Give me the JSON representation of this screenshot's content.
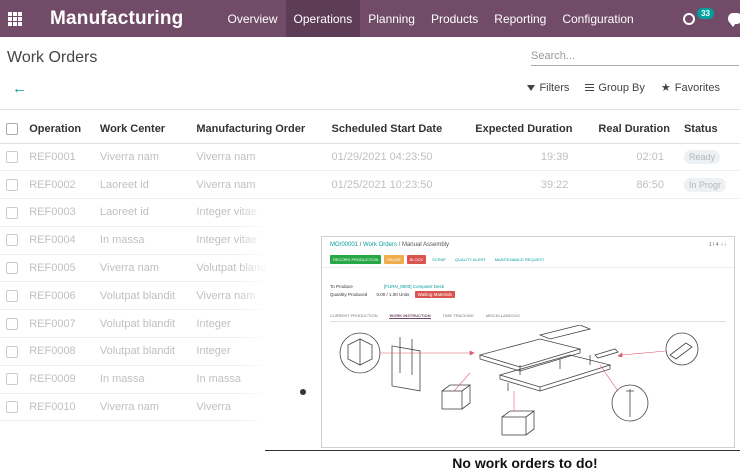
{
  "navbar": {
    "app_title": "Manufacturing",
    "menu": [
      "Overview",
      "Operations",
      "Planning",
      "Products",
      "Reporting",
      "Configuration"
    ],
    "active_menu": "Operations",
    "activity_count": "33",
    "color": "#714B67"
  },
  "control_panel": {
    "breadcrumb": "Work Orders",
    "search_placeholder": "Search...",
    "filters_label": "Filters",
    "group_by_label": "Group By",
    "favorites_label": "Favorites"
  },
  "table": {
    "columns": [
      "Operation",
      "Work Center",
      "Manufacturing Order",
      "Scheduled Start Date",
      "Expected Duration",
      "Real Duration",
      "Status"
    ],
    "rows": [
      {
        "operation": "REF0001",
        "work_center": "Viverra nam",
        "mo": "Viverra nam",
        "start": "01/29/2021 04:23:50",
        "expected": "19:39",
        "real": "02:01",
        "status": "Ready"
      },
      {
        "operation": "REF0002",
        "work_center": "Laoreet id",
        "mo": "Viverra nam",
        "start": "01/25/2021 10:23:50",
        "expected": "39:22",
        "real": "86:50",
        "status": "In Progr"
      },
      {
        "operation": "REF0003",
        "work_center": "Laoreet id",
        "mo": "Integer vitae",
        "start": "",
        "expected": "",
        "real": "",
        "status": ""
      },
      {
        "operation": "REF0004",
        "work_center": "In massa",
        "mo": "Integer vitae",
        "start": "",
        "expected": "",
        "real": "",
        "status": ""
      },
      {
        "operation": "REF0005",
        "work_center": "Viverra nam",
        "mo": "Volutpat blandit",
        "start": "",
        "expected": "",
        "real": "",
        "status": ""
      },
      {
        "operation": "REF0006",
        "work_center": "Volutpat blandit",
        "mo": "Viverra nam",
        "start": "",
        "expected": "",
        "real": "",
        "status": ""
      },
      {
        "operation": "REF0007",
        "work_center": "Volutpat blandit",
        "mo": "Integer",
        "start": "",
        "expected": "",
        "real": "",
        "status": ""
      },
      {
        "operation": "REF0008",
        "work_center": "Volutpat blandit",
        "mo": "Integer",
        "start": "",
        "expected": "",
        "real": "",
        "status": ""
      },
      {
        "operation": "REF0009",
        "work_center": "In massa",
        "mo": "In massa",
        "start": "",
        "expected": "",
        "real": "",
        "status": ""
      },
      {
        "operation": "REF0010",
        "work_center": "Viverra nam",
        "mo": "Viverra",
        "start": "",
        "expected": "",
        "real": "",
        "status": ""
      }
    ]
  },
  "helper": {
    "title": "No work orders to do!",
    "screenshot": {
      "breadcrumb_mo": "MO/00001",
      "breadcrumb_sep1": " / ",
      "breadcrumb_wo": "Work Orders",
      "breadcrumb_sep2": " / ",
      "breadcrumb_current": "Manual Assembly",
      "pager": "1 / 4",
      "buttons": [
        {
          "label": "RECORD PRODUCTION",
          "color": "#28a745"
        },
        {
          "label": "PAUSE",
          "color": "#f0ad4e"
        },
        {
          "label": "BLOCK",
          "color": "#d9534f"
        },
        {
          "label": "SCRAP",
          "color": ""
        },
        {
          "label": "QUALITY ALERT",
          "color": ""
        },
        {
          "label": "MAINTENANCE REQUEST",
          "color": ""
        }
      ],
      "to_produce_label": "To Produce",
      "to_produce_value": "[FURN_8900] Computer Desk",
      "qty_label": "Quantity Produced",
      "qty_value": "0.00 / 1.00 Units",
      "qty_status": "Waiting Materials",
      "tabs": [
        "CURRENT PRODUCTION",
        "WORK INSTRUCTION",
        "TIME TRACKING",
        "MISCELLANEOUS"
      ],
      "active_tab": "WORK INSTRUCTION"
    }
  }
}
